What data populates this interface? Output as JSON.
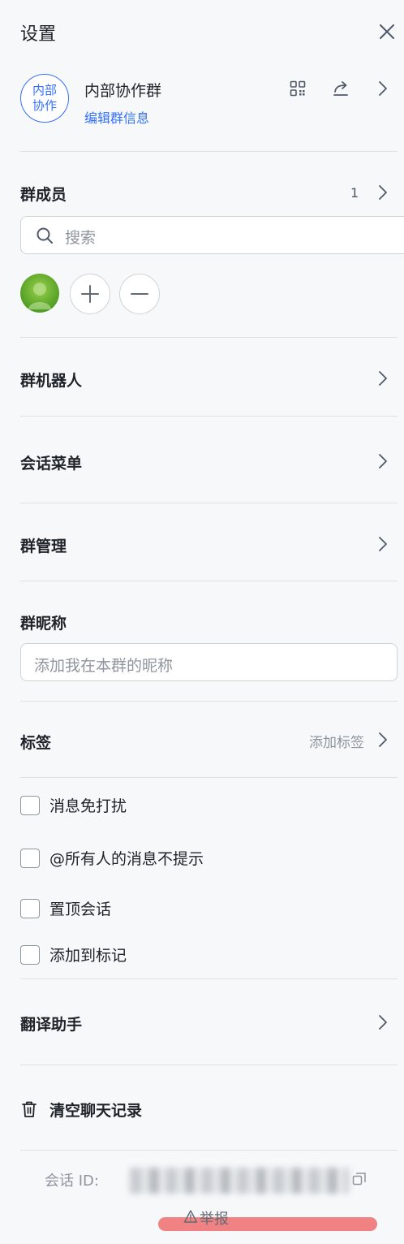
{
  "header": {
    "title": "设置"
  },
  "group": {
    "avatar_text": "内部协作",
    "name": "内部协作群",
    "edit_label": "编辑群信息"
  },
  "members": {
    "title": "群成员",
    "count": "1",
    "search_placeholder": "搜索"
  },
  "sections": {
    "bots": "群机器人",
    "menu": "会话菜单",
    "manage": "群管理"
  },
  "nickname": {
    "title": "群昵称",
    "placeholder": "添加我在本群的昵称"
  },
  "tags": {
    "title": "标签",
    "add_label": "添加标签"
  },
  "options": [
    {
      "label": "消息免打扰",
      "checked": false
    },
    {
      "label": "@所有人的消息不提示",
      "checked": false
    },
    {
      "label": "置顶会话",
      "checked": false
    },
    {
      "label": "添加到标记",
      "checked": false
    }
  ],
  "translate": {
    "title": "翻译助手"
  },
  "clear": {
    "label": "清空聊天记录"
  },
  "footer": {
    "session_id_label": "会话 ID:",
    "report_label": "举报"
  },
  "colors": {
    "accent": "#3370ff",
    "text": "#1f2329",
    "muted": "#8f959e",
    "divider": "#dee0e3",
    "background": "#f7f8fa",
    "report_highlight": "#ef6d6d"
  }
}
